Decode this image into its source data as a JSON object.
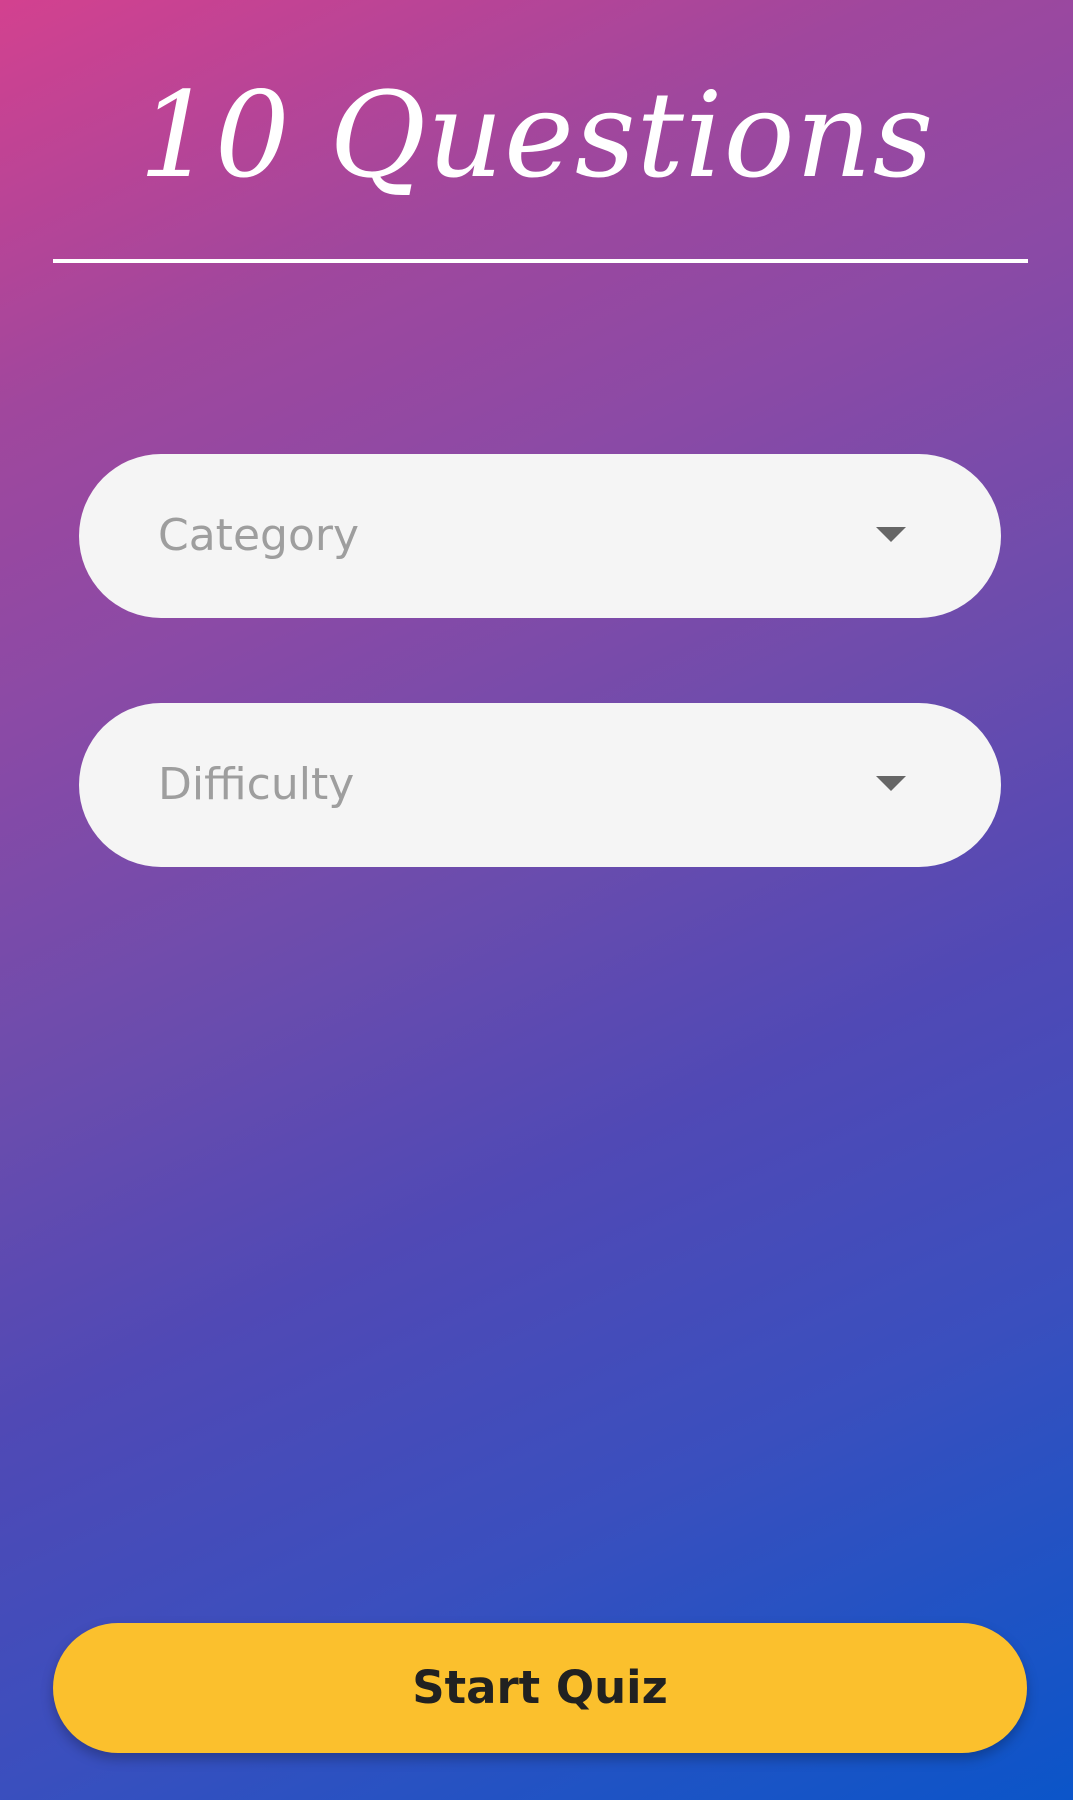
{
  "header": {
    "title": "10 Questions"
  },
  "form": {
    "category": {
      "placeholder": "Category",
      "icon": "dropdown-caret-icon"
    },
    "difficulty": {
      "placeholder": "Difficulty",
      "icon": "dropdown-caret-icon"
    }
  },
  "actions": {
    "start_label": "Start Quiz"
  },
  "colors": {
    "gradient_start": "#d3418f",
    "gradient_end": "#0b55c9",
    "select_bg": "#f5f5f5",
    "placeholder_text": "#9e9e9e",
    "button_bg": "#fbc02d",
    "button_text": "#212121"
  }
}
